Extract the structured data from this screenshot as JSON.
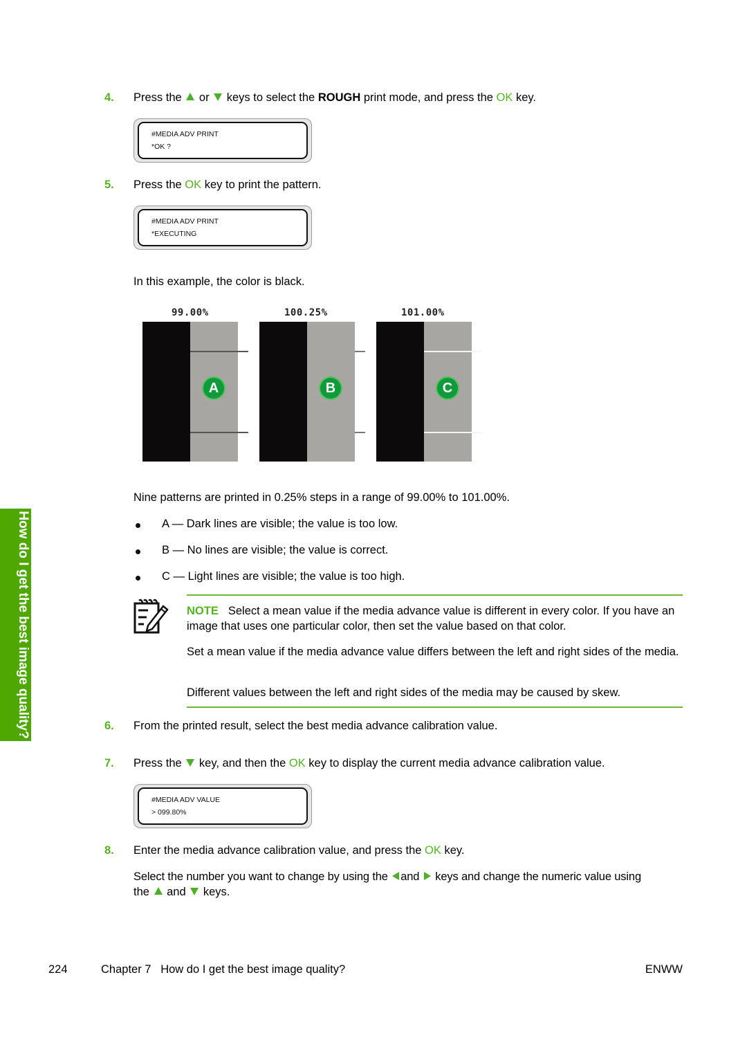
{
  "sidebar": {
    "tab_label": "How do I get the best image quality?"
  },
  "colors": {
    "accent_green": "#55b520",
    "sidebar_green": "#4fa802",
    "badge_green": "#0f9a3c"
  },
  "steps": {
    "s4": {
      "number": "4.",
      "text_1": "Press the",
      "icon_1": "up-arrow-key-icon",
      "text_2": "or",
      "icon_2": "down-arrow-key-icon",
      "text_3": "keys to select the",
      "bold": "ROUGH",
      "text_4": "print mode, and press the",
      "ok": "OK",
      "text_5": "key.",
      "lcd": {
        "line1": "#MEDIA ADV PRINT",
        "line2": "*OK ?"
      }
    },
    "s5": {
      "number": "5.",
      "text_1": "Press the",
      "ok": "OK",
      "text_2": "key to print the pattern.",
      "lcd": {
        "line1": "#MEDIA ADV PRINT",
        "line2": "*EXECUTING"
      },
      "example_text": "In this example, the color is black."
    },
    "s6": {
      "number": "6.",
      "text": "From the printed result, select the best media advance calibration value."
    },
    "s7": {
      "number": "7.",
      "text_1": "Press the",
      "icon_1": "down-arrow-key-icon",
      "text_2": "key, and then the",
      "ok": "OK",
      "text_3": "key to display the current media advance calibration value.",
      "lcd": {
        "line1": "#MEDIA ADV VALUE",
        "line2": "> 099.80%"
      }
    },
    "s8": {
      "number": "8.",
      "text_1": "Enter the media advance calibration value, and press the",
      "ok": "OK",
      "text_2": "key.",
      "sub_1": "Select the number you want to change by using the",
      "sub_icon_1": "left-arrow-key-icon",
      "sub_2": "and",
      "sub_icon_2": "right-arrow-key-icon",
      "sub_3": "keys and change the numeric value using",
      "sub_4": "the",
      "sub_icon_3": "up-arrow-key-icon",
      "sub_5": "and",
      "sub_icon_4": "down-arrow-key-icon",
      "sub_6": "keys."
    }
  },
  "patterns": [
    {
      "label": "99.00%",
      "badge": "A",
      "lines": "dark"
    },
    {
      "label": "100.25%",
      "badge": "B",
      "lines": "none"
    },
    {
      "label": "101.00%",
      "badge": "C",
      "lines": "light"
    }
  ],
  "patterns_text": "Nine patterns are printed in 0.25% steps in a range of 99.00% to 101.00%.",
  "bullets": [
    "A — Dark lines are visible; the value is too low.",
    "B — No lines are visible; the value is correct.",
    "C — Light lines are visible; the value is too high."
  ],
  "note": {
    "icon": "note-pencil-icon",
    "label": "NOTE",
    "para1": "Select a mean value if the media advance value is different in every color. If you have an image that uses one particular color, then set the value based on that color.",
    "para2": "Set a mean value if the media advance value differs between the left and right sides of the media.",
    "para3": "Different values between the left and right sides of the media may be caused by skew."
  },
  "footer": {
    "page_number": "224",
    "chapter": "Chapter 7   How do I get the best image quality?",
    "locale": "ENWW"
  }
}
